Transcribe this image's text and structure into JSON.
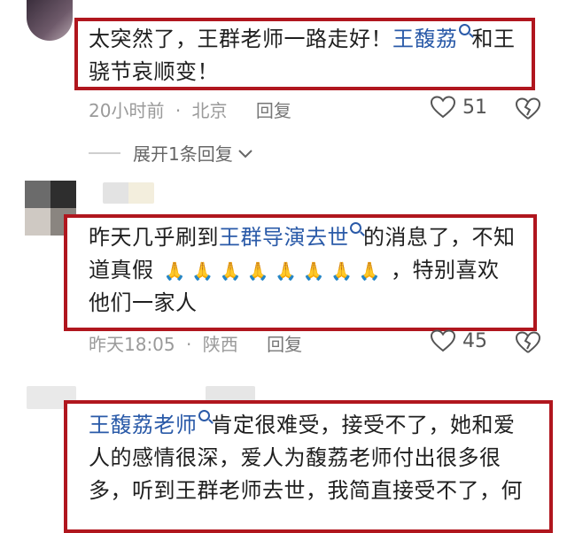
{
  "comments": [
    {
      "text_parts": [
        "太突然了，王群老师一路走好！",
        "王馥荔",
        "和王",
        "骁节哀顺变！"
      ],
      "meta": {
        "time": "20小时前",
        "separator": "·",
        "location": "北京",
        "reply": "回复"
      },
      "likes": "51"
    },
    {
      "expand_label": "展开1条回复"
    },
    {
      "text_parts": [
        "昨天几乎刷到",
        "王群导演去世",
        "的消息了，不知",
        "道真假",
        "，特别喜欢",
        "他们一家人"
      ],
      "pray_count": 8,
      "meta": {
        "time": "昨天18:05",
        "separator": "·",
        "location": "陕西",
        "reply": "回复"
      },
      "likes": "45"
    },
    {
      "text_parts": [
        "王馥荔老师",
        "肯定很难受，接受不了，她和爱",
        "人的感情很深，爱人为馥荔老师付出很多很",
        "多，听到王群老师去世，我简直接受不了，何"
      ]
    }
  ],
  "colors": {
    "box_border": "#b0161e",
    "link": "#2a5aa8",
    "meta": "#9a9a9a"
  }
}
